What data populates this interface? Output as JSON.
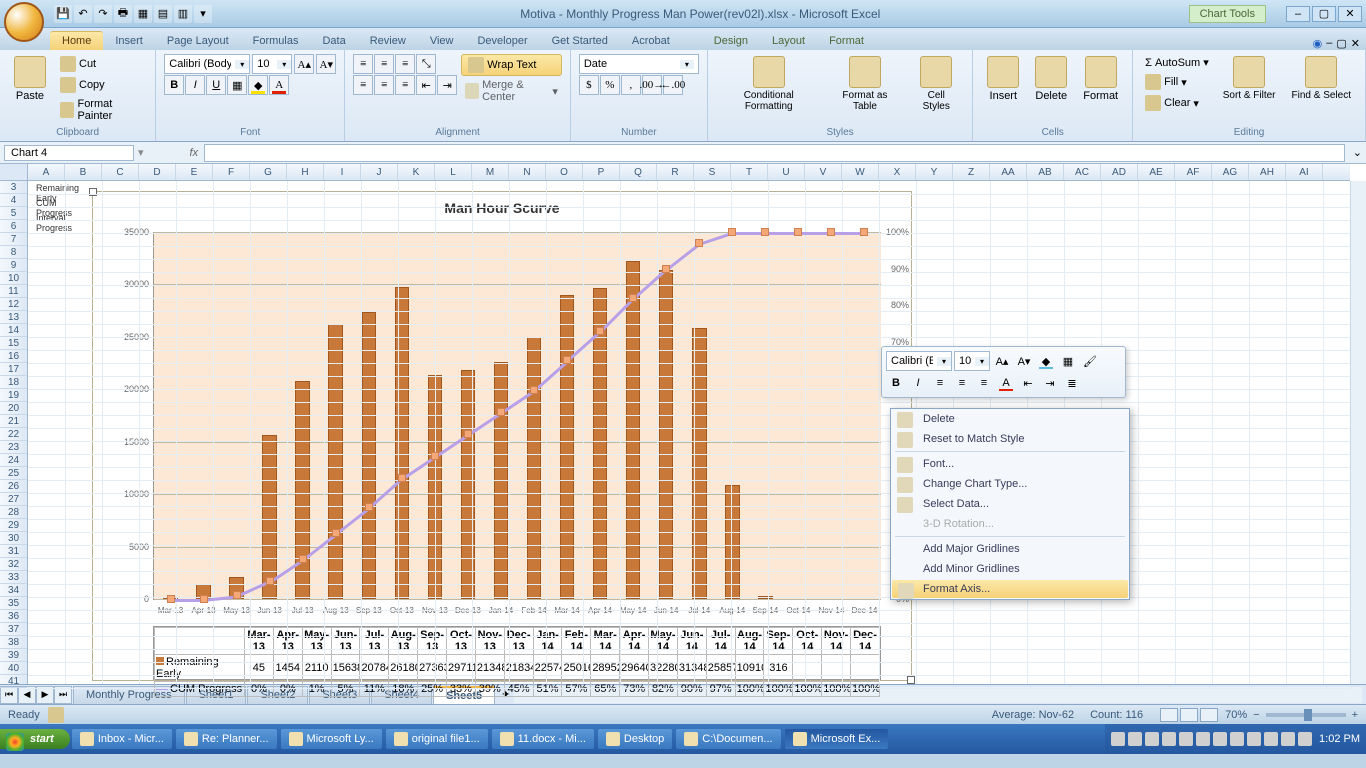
{
  "titlebar": {
    "title": "Motiva - Monthly Progress  Man Power(rev02l).xlsx - Microsoft Excel",
    "chart_tools": "Chart Tools"
  },
  "tabs": [
    "Home",
    "Insert",
    "Page Layout",
    "Formulas",
    "Data",
    "Review",
    "View",
    "Developer",
    "Get Started",
    "Acrobat"
  ],
  "chart_tabs": [
    "Design",
    "Layout",
    "Format"
  ],
  "active_tab": "Home",
  "ribbon": {
    "clipboard": {
      "label": "Clipboard",
      "paste": "Paste",
      "cut": "Cut",
      "copy": "Copy",
      "format_painter": "Format Painter"
    },
    "font": {
      "label": "Font",
      "name": "Calibri (Body)",
      "size": "10"
    },
    "alignment": {
      "label": "Alignment",
      "wrap_text": "Wrap Text",
      "merge_center": "Merge & Center"
    },
    "number": {
      "label": "Number",
      "format": "Date"
    },
    "styles": {
      "label": "Styles",
      "conditional": "Conditional Formatting",
      "format_table": "Format as Table",
      "cell_styles": "Cell Styles"
    },
    "cells": {
      "label": "Cells",
      "insert": "Insert",
      "delete": "Delete",
      "format": "Format"
    },
    "editing": {
      "label": "Editing",
      "autosum": "AutoSum",
      "fill": "Fill",
      "clear": "Clear",
      "sort": "Sort & Filter",
      "find": "Find & Select"
    }
  },
  "name_box": "Chart 4",
  "columns": [
    "A",
    "B",
    "C",
    "D",
    "E",
    "F",
    "G",
    "H",
    "I",
    "J",
    "K",
    "L",
    "M",
    "N",
    "O",
    "P",
    "Q",
    "R",
    "S",
    "T",
    "U",
    "V",
    "W",
    "X",
    "Y",
    "Z",
    "AA",
    "AB",
    "AC",
    "AD",
    "AE",
    "AF",
    "AG",
    "AH",
    "AI"
  ],
  "row_start": 3,
  "row_count": 39,
  "frozen_labels": {
    "r3": "Remaining Early",
    "r4": "CUM Progress",
    "r5": "Interval Progress"
  },
  "chart_data": {
    "type": "combo-bar-line",
    "title": "Man Hour Scurve",
    "categories": [
      "Mar-13",
      "Apr-13",
      "May-13",
      "Jun-13",
      "Jul-13",
      "Aug-13",
      "Sep-13",
      "Oct-13",
      "Nov-13",
      "Dec-13",
      "Jan-14",
      "Feb-14",
      "Mar-14",
      "Apr-14",
      "May-14",
      "Jun-14",
      "Jul-14",
      "Aug-14",
      "Sep-14",
      "Oct-14",
      "Nov-14",
      "Dec-14"
    ],
    "series": [
      {
        "name": "Remaining Early",
        "type": "bar",
        "values": [
          45,
          1454,
          2110,
          15638,
          20784,
          26180,
          27363,
          29711,
          21348,
          21834,
          22574,
          25016,
          28952,
          29640,
          32280,
          31348,
          25857,
          10910,
          316,
          0,
          0,
          0
        ]
      },
      {
        "name": "CUM Progress",
        "type": "line",
        "axis": "secondary",
        "values_pct": [
          0,
          0,
          1,
          5,
          11,
          18,
          25,
          33,
          39,
          45,
          51,
          57,
          65,
          73,
          82,
          90,
          97,
          100,
          100,
          100,
          100,
          100
        ]
      }
    ],
    "y1": {
      "min": 0,
      "max": 35000,
      "step": 5000
    },
    "y2": {
      "min": 0,
      "max": 100,
      "step": 10,
      "suffix": "%"
    },
    "data_table_rows": [
      "Remaining Early",
      "CUM Progress"
    ]
  },
  "mini_toolbar": {
    "font": "Calibri (E",
    "size": "10"
  },
  "context_menu": {
    "items": [
      {
        "label": "Delete",
        "icon": true
      },
      {
        "label": "Reset to Match Style",
        "icon": true
      },
      {
        "sep": true
      },
      {
        "label": "Font...",
        "icon": true
      },
      {
        "label": "Change Chart Type...",
        "icon": true
      },
      {
        "label": "Select Data...",
        "icon": true
      },
      {
        "label": "3-D Rotation...",
        "disabled": true
      },
      {
        "sep": true
      },
      {
        "label": "Add Major Gridlines"
      },
      {
        "label": "Add Minor Gridlines"
      },
      {
        "label": "Format Axis...",
        "highlight": true,
        "icon": true
      }
    ]
  },
  "sheet_tabs": [
    "Monthly Progress",
    "Sheet1",
    "Sheet2",
    "Sheet3",
    "Sheet4",
    "Sheet5"
  ],
  "active_sheet": "Sheet5",
  "status": {
    "ready": "Ready",
    "average": "Average: Nov-62",
    "count": "Count: 116",
    "zoom": "70%"
  },
  "taskbar": {
    "start": "start",
    "items": [
      "Inbox - Micr...",
      "Re: Planner...",
      "Microsoft Ly...",
      "original file1...",
      "11.docx - Mi...",
      "Desktop",
      "C:\\Documen...",
      "Microsoft Ex..."
    ],
    "active_item": 7,
    "clock": "1:02 PM"
  }
}
